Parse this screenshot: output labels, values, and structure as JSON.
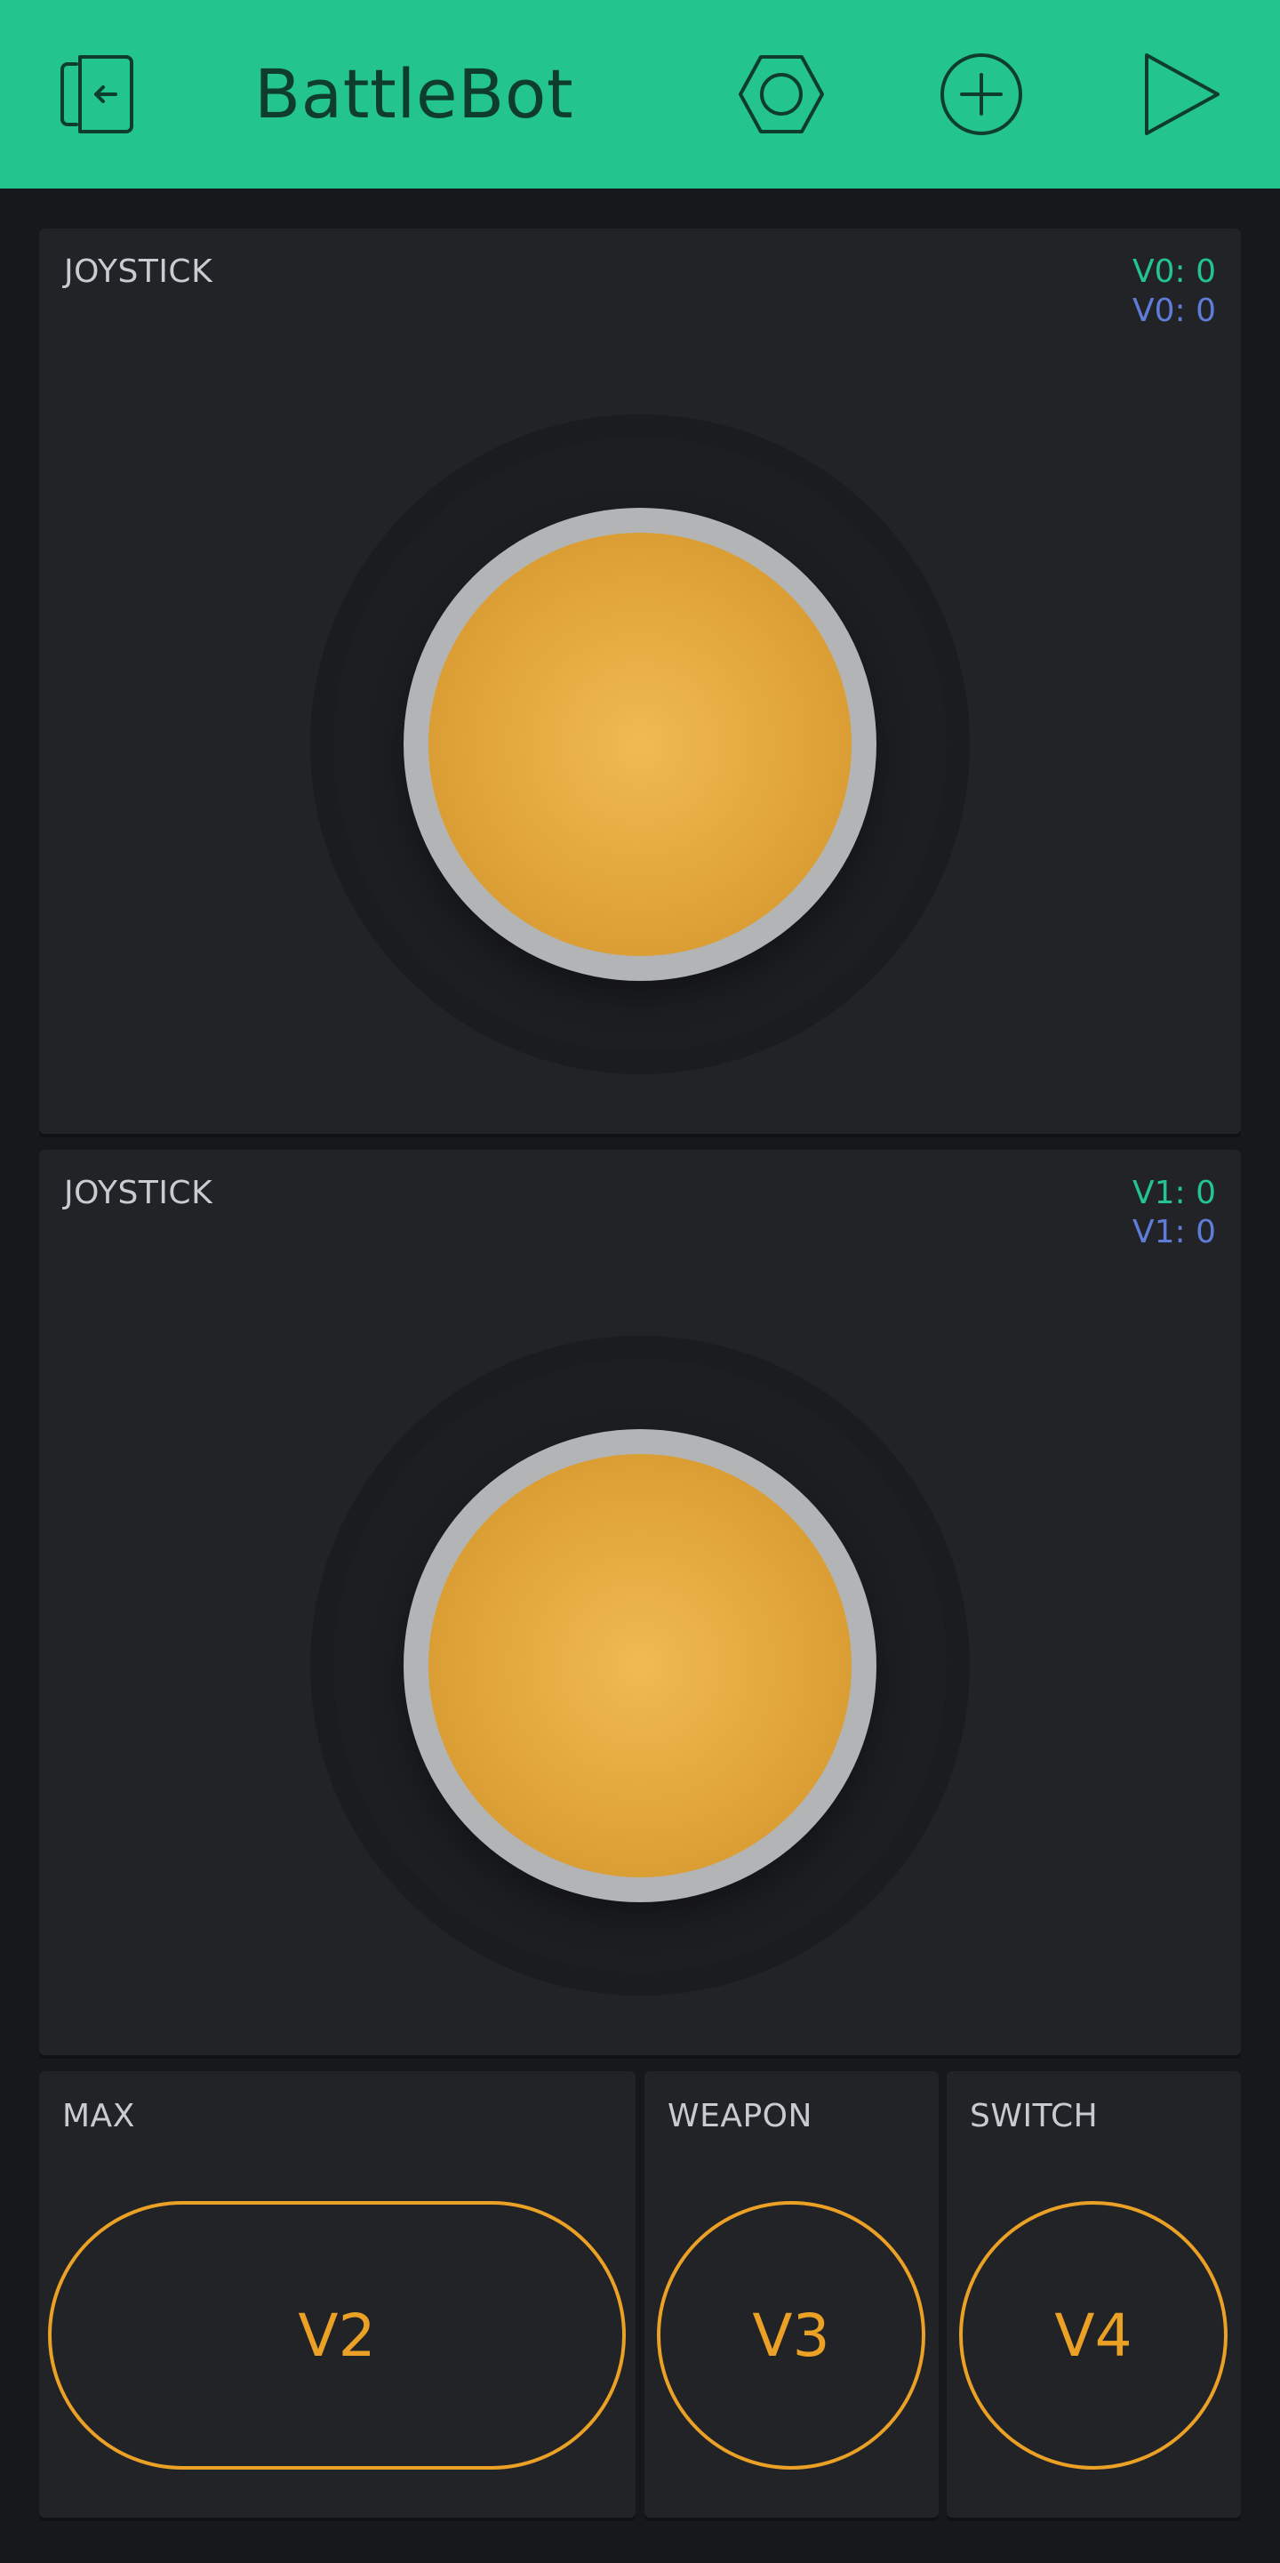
{
  "header": {
    "title": "BattleBot",
    "icons": [
      "exit-icon",
      "settings-hex-icon",
      "add-icon",
      "play-icon"
    ]
  },
  "joysticks": [
    {
      "label": "JOYSTICK",
      "pin_x": "V0: 0",
      "pin_y": "V0: 0"
    },
    {
      "label": "JOYSTICK",
      "pin_x": "V1: 0",
      "pin_y": "V1: 0"
    }
  ],
  "buttons": [
    {
      "label": "MAX",
      "pin": "V2"
    },
    {
      "label": "WEAPON",
      "pin": "V3"
    },
    {
      "label": "SWITCH",
      "pin": "V4"
    }
  ],
  "colors": {
    "header_bg": "#23c48e",
    "background": "#17181c",
    "panel": "#222327",
    "accent_orange": "#eba125",
    "pin_green": "#23c48e",
    "pin_blue": "#5f7cd8"
  }
}
